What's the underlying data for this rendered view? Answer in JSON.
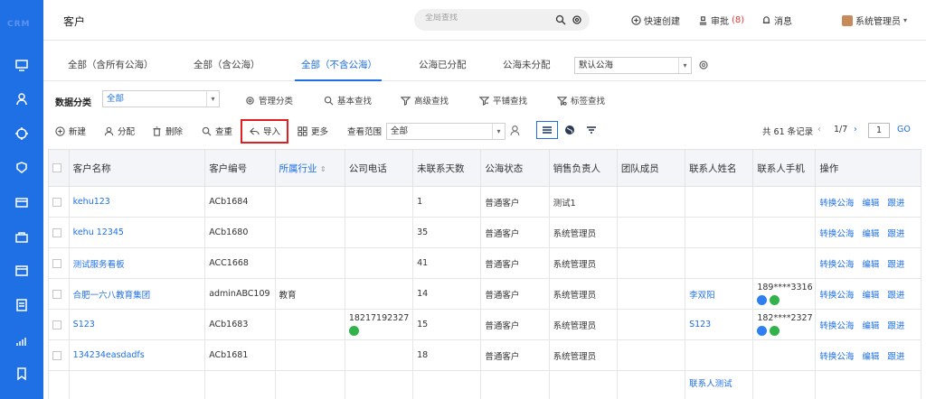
{
  "sidebar": {
    "logo": "CRM",
    "icons": [
      "monitor-icon",
      "user-icon",
      "crosshair-icon",
      "shield-icon",
      "folder-icon",
      "bag-icon",
      "box-icon",
      "list-icon",
      "chart-icon",
      "bookmark-icon"
    ]
  },
  "header": {
    "title": "客户",
    "search_placeholder": "全局查找",
    "quick_create": "快速创建",
    "approval": "审批",
    "approval_count": "(8)",
    "messages": "消息",
    "user": "系统管理员"
  },
  "tabs": {
    "items": [
      "全部（含所有公海）",
      "全部（含公海）",
      "全部（不含公海）",
      "公海已分配",
      "公海未分配"
    ],
    "active_index": 2,
    "pool_select": "默认公海"
  },
  "filter": {
    "label": "数据分类",
    "category_value": "全部",
    "manage": "管理分类",
    "basic_search": "基本查找",
    "advanced_search": "高级查找",
    "flat_search": "平铺查找",
    "tag_search": "标签查找"
  },
  "toolbar": {
    "new": "新建",
    "assign": "分配",
    "delete": "删除",
    "dedupe": "查重",
    "import": "导入",
    "more": "更多",
    "scope_label": "查看范围",
    "scope_value": "全部",
    "total": "共 61 条记录",
    "page": "1/7",
    "page_input": "1",
    "go": "GO"
  },
  "table": {
    "headers": [
      "客户名称",
      "客户编号",
      "所属行业",
      "公司电话",
      "未联系天数",
      "公海状态",
      "销售负责人",
      "团队成员",
      "联系人姓名",
      "联系人手机",
      "操作"
    ],
    "sort_indicator": "⇕",
    "ops": [
      "转换公海",
      "编辑",
      "跟进"
    ],
    "rows": [
      {
        "name": "kehu123",
        "code": "ACb1684",
        "industry": "",
        "phone": "",
        "days": "1",
        "status": "普通客户",
        "owner": "测试1",
        "team": "",
        "contact": "",
        "mobile": ""
      },
      {
        "name": "kehu 12345",
        "code": "ACb1680",
        "industry": "",
        "phone": "",
        "days": "35",
        "status": "普通客户",
        "owner": "系统管理员",
        "team": "",
        "contact": "",
        "mobile": ""
      },
      {
        "name": "测试服务看板",
        "code": "ACC1668",
        "industry": "",
        "phone": "",
        "days": "41",
        "status": "普通客户",
        "owner": "系统管理员",
        "team": "",
        "contact": "",
        "mobile": ""
      },
      {
        "name": "合肥一六八教育集团",
        "code": "adminABC109",
        "industry": "教育",
        "phone": "",
        "days": "14",
        "status": "普通客户",
        "owner": "系统管理员",
        "team": "",
        "contact": "李双阳",
        "mobile": "189****3316"
      },
      {
        "name": "S123",
        "code": "ACb1683",
        "industry": "",
        "phone": "18217192327",
        "days": "15",
        "status": "普通客户",
        "owner": "系统管理员",
        "team": "",
        "contact": "S123",
        "mobile": "182****2327"
      },
      {
        "name": "134234easdadfs",
        "code": "ACb1681",
        "industry": "",
        "phone": "",
        "days": "18",
        "status": "普通客户",
        "owner": "系统管理员",
        "team": "",
        "contact": "",
        "mobile": ""
      },
      {
        "name": "",
        "code": "",
        "industry": "",
        "phone": "",
        "days": "",
        "status": "",
        "owner": "",
        "team": "",
        "contact": "联系人测试",
        "mobile": ""
      }
    ]
  }
}
